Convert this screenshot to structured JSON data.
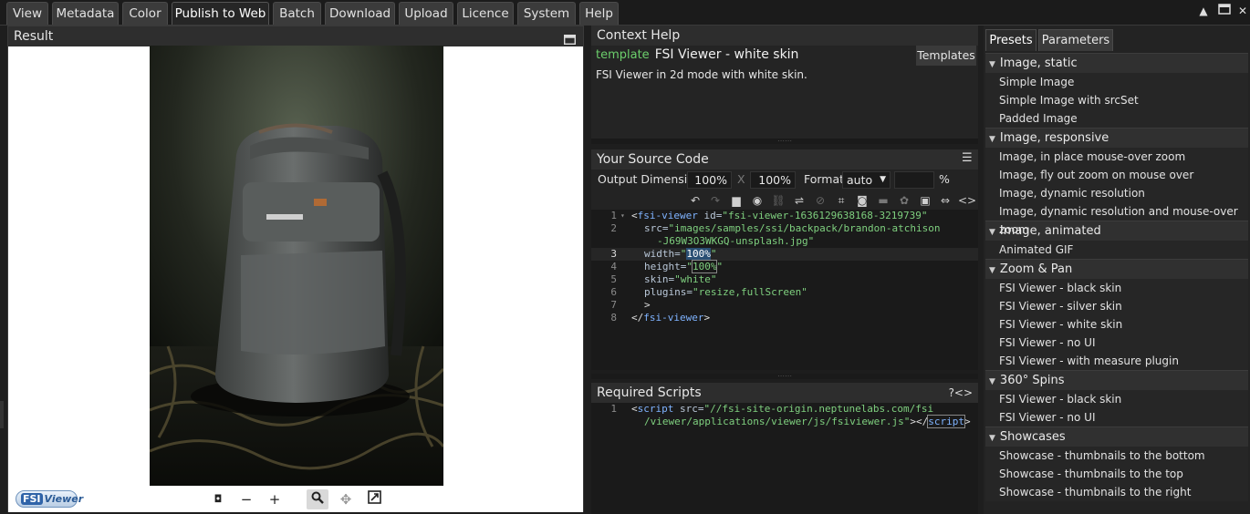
{
  "tabs": [
    "View",
    "Metadata",
    "Color",
    "Publish to Web",
    "Batch",
    "Download",
    "Upload",
    "Licence",
    "System",
    "Help"
  ],
  "active_tab": "Publish to Web",
  "result": {
    "title": "Result",
    "logo_text": "FSI Viewer"
  },
  "context_help": {
    "title": "Context Help",
    "keyword": "template",
    "template_name": "FSI Viewer - white skin",
    "templates_button": "Templates",
    "description": "FSI Viewer in 2d mode with white skin."
  },
  "source": {
    "title": "Your Source Code",
    "output_label": "Output Dimension",
    "width": "100%",
    "x_sep": "X",
    "height": "100%",
    "format_label": "Format",
    "format_value": "auto",
    "quality_value": "",
    "pct": "%",
    "lines": [
      {
        "n": "1",
        "fold": true
      },
      {
        "n": "2"
      },
      {
        "n": ""
      },
      {
        "n": "3"
      },
      {
        "n": "4"
      },
      {
        "n": "5"
      },
      {
        "n": "6"
      },
      {
        "n": "7"
      },
      {
        "n": "8"
      }
    ],
    "code": {
      "l1_tag": "fsi-viewer",
      "l1_attr": " id=",
      "l1_val": "\"fsi-viewer-1636129638168-3219739\"",
      "l2_attr": "src=",
      "l2_val": "\"images/samples/ssi/backpack/brandon-atchison",
      "l2b_val": "-J69W3O3WKGQ-unsplash.jpg\"",
      "l3_attr": "width=",
      "l3_val": "100%",
      "l4_attr": "height=",
      "l4_val": "100%",
      "l5_attr": "skin=",
      "l5_val": "\"white\"",
      "l6_attr": "plugins=",
      "l6_val": "\"resize,fullScreen\"",
      "l7": ">",
      "l8_tag": "fsi-viewer"
    }
  },
  "required": {
    "title": "Required Scripts",
    "help": "?",
    "code_icon": "<>",
    "line": "1",
    "l1_tag": "script",
    "l1_attr": " src=",
    "l1_val": "\"//fsi-site-origin.neptunelabs.com/fsi",
    "l1b_val": "/viewer/applications/viewer/js/fsiviewer.js\"",
    "l1_close": "script"
  },
  "presets": {
    "tab_presets": "Presets",
    "tab_parameters": "Parameters",
    "groups": [
      {
        "name": "Image, static",
        "items": [
          "Simple Image",
          "Simple Image with srcSet",
          "Padded Image"
        ]
      },
      {
        "name": "Image, responsive",
        "items": [
          "Image, in place mouse-over zoom",
          "Image, fly out zoom on mouse over",
          "Image, dynamic resolution",
          "Image, dynamic resolution and mouse-over zoom"
        ]
      },
      {
        "name": "Image, animated",
        "items": [
          "Animated GIF"
        ]
      },
      {
        "name": "Zoom & Pan",
        "items": [
          "FSI Viewer - black skin",
          "FSI Viewer - silver skin",
          "FSI Viewer - white skin",
          "FSI Viewer - no UI",
          "FSI Viewer - with measure plugin"
        ]
      },
      {
        "name": "360° Spins",
        "items": [
          "FSI Viewer - black skin",
          "FSI Viewer - no UI"
        ]
      },
      {
        "name": "Showcases",
        "items": [
          "Showcase - thumbnails to the bottom",
          "Showcase - thumbnails to the top",
          "Showcase - thumbnails to the right"
        ]
      }
    ]
  }
}
